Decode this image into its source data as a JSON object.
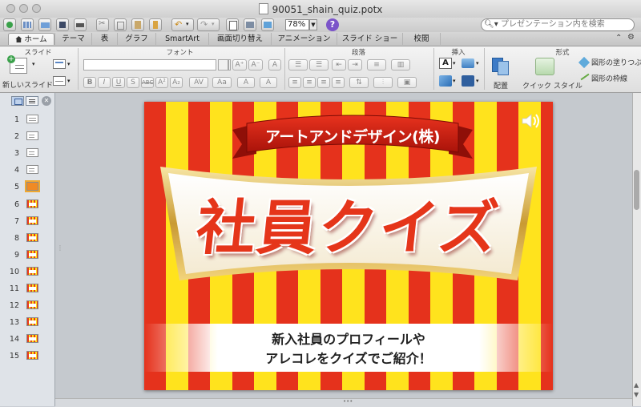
{
  "window": {
    "title": "90051_shain_quiz.potx"
  },
  "toolbar": {
    "zoom": "78%",
    "search_placeholder": "プレゼンテーション内を検索"
  },
  "tabs": [
    "ホーム",
    "テーマ",
    "表",
    "グラフ",
    "SmartArt",
    "画面切り替え",
    "アニメーション",
    "スライド ショー",
    "校閲"
  ],
  "ribbon": {
    "groups": {
      "slide": "スライド",
      "font": "フォント",
      "paragraph": "段落",
      "insert": "挿入",
      "format": "形式"
    },
    "new_slide": "新しいスライド",
    "arrange": "配置",
    "quick_style": "クイック スタイル",
    "shape_fill": "図形の塗りつぶし",
    "shape_outline": "図形の枠線"
  },
  "slides_panel": {
    "numbers": [
      "1",
      "2",
      "3",
      "4",
      "5",
      "6",
      "7",
      "8",
      "9",
      "10",
      "11",
      "12",
      "13",
      "14",
      "15"
    ],
    "selected_index": 5
  },
  "slide": {
    "banner": "アートアンドデザイン(株)",
    "title": "社員クイズ",
    "subtitle_line1": "新入社員のプロフィールや",
    "subtitle_line2": "アレコレをクイズでご紹介！"
  },
  "colors": {
    "stripe_red": "#e5321c",
    "stripe_yellow": "#ffe31d",
    "title_red": "#e5351a"
  }
}
